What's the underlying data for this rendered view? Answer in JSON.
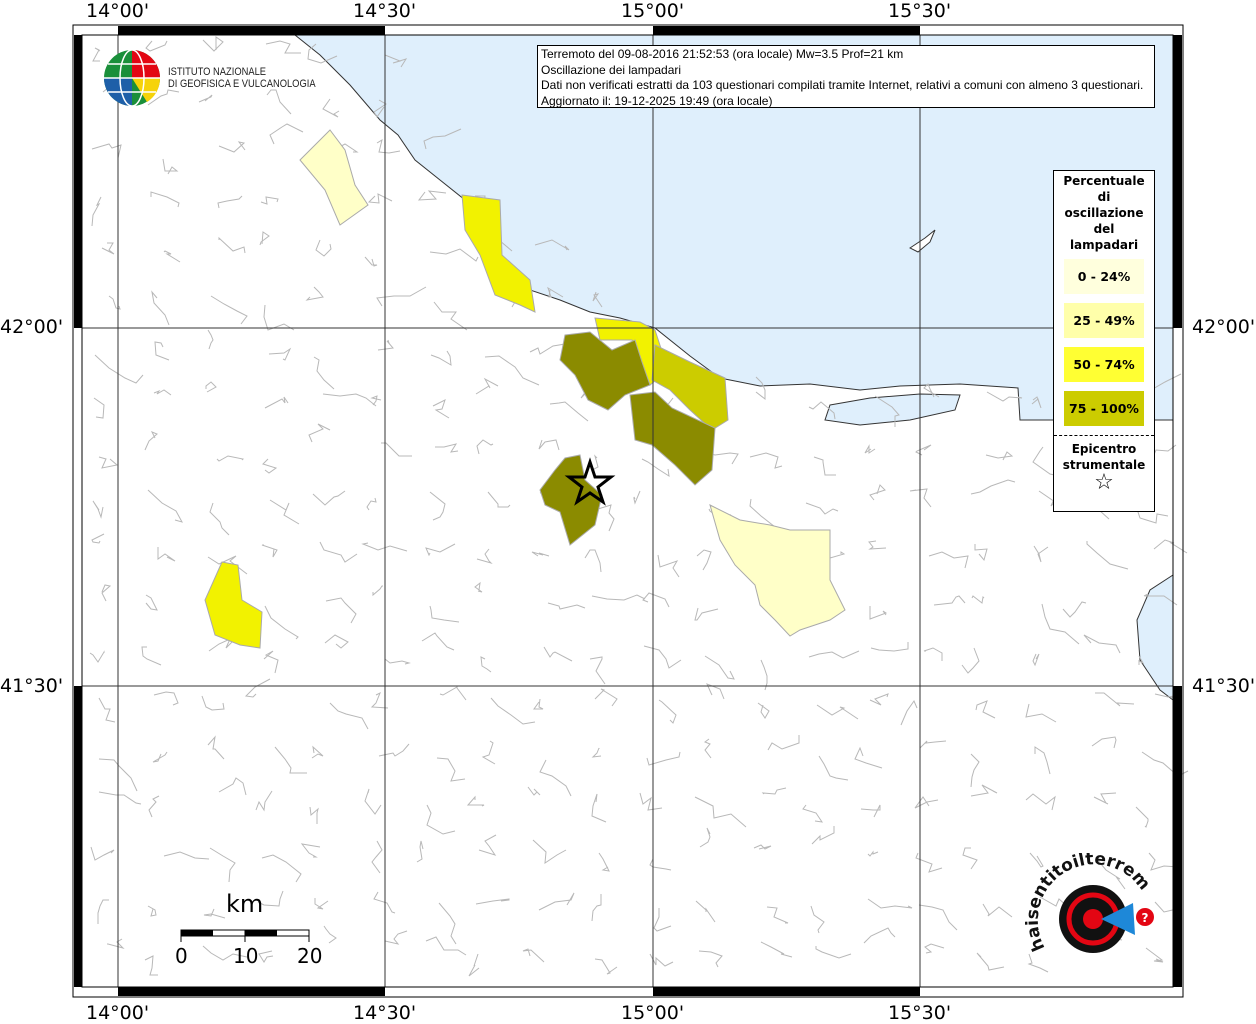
{
  "info_box": {
    "line1": "Terremoto del 09-08-2016 21:52:53 (ora locale) Mw=3.5 Prof=21 km",
    "line2": "Oscillazione dei lampadari",
    "line3": "Dati non verificati estratti da 103 questionari compilati tramite Internet, relativi a comuni con almeno 3 questionari.",
    "line4": "Aggiornato il: 19-12-2025 19:49 (ora locale)"
  },
  "axes": {
    "lon_ticks": [
      "14°00'",
      "14°30'",
      "15°00'",
      "15°30'"
    ],
    "lat_ticks": [
      "42°00'",
      "41°30'"
    ]
  },
  "logo_ingv": {
    "line1": "ISTITUTO NAZIONALE",
    "line2": "DI GEOFISICA E VULCANOLOGIA"
  },
  "legend": {
    "title_lines": [
      "Percentuale",
      "di",
      "oscillazione",
      "del",
      "lampadari"
    ],
    "classes": [
      {
        "label": "0 - 24%",
        "color": "#ffffdd"
      },
      {
        "label": "25 - 49%",
        "color": "#ffffaa"
      },
      {
        "label": "50 - 74%",
        "color": "#ffff33"
      },
      {
        "label": "75 - 100%",
        "color": "#cccc00"
      }
    ],
    "epicenter_lines": [
      "Epicentro",
      "strumentale"
    ]
  },
  "scale_bar": {
    "unit": "km",
    "labels": [
      "0",
      "10",
      "20"
    ]
  },
  "logo_hst": {
    "text": "www.haisentitoilterremoto.it"
  },
  "colors": {
    "sea": "#ddeeff",
    "class_dark": "#8b8b00"
  }
}
